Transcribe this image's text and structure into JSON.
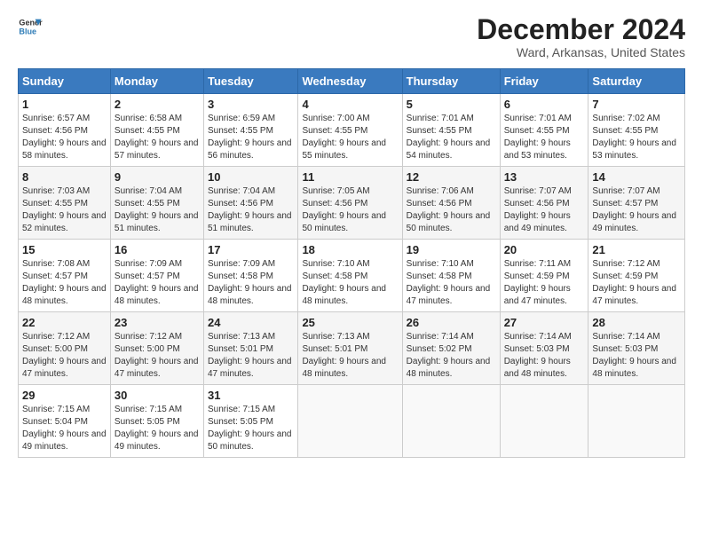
{
  "logo": {
    "general": "General",
    "blue": "Blue"
  },
  "title": "December 2024",
  "subtitle": "Ward, Arkansas, United States",
  "headers": [
    "Sunday",
    "Monday",
    "Tuesday",
    "Wednesday",
    "Thursday",
    "Friday",
    "Saturday"
  ],
  "weeks": [
    [
      {
        "day": "1",
        "sunrise": "Sunrise: 6:57 AM",
        "sunset": "Sunset: 4:56 PM",
        "daylight": "Daylight: 9 hours and 58 minutes."
      },
      {
        "day": "2",
        "sunrise": "Sunrise: 6:58 AM",
        "sunset": "Sunset: 4:55 PM",
        "daylight": "Daylight: 9 hours and 57 minutes."
      },
      {
        "day": "3",
        "sunrise": "Sunrise: 6:59 AM",
        "sunset": "Sunset: 4:55 PM",
        "daylight": "Daylight: 9 hours and 56 minutes."
      },
      {
        "day": "4",
        "sunrise": "Sunrise: 7:00 AM",
        "sunset": "Sunset: 4:55 PM",
        "daylight": "Daylight: 9 hours and 55 minutes."
      },
      {
        "day": "5",
        "sunrise": "Sunrise: 7:01 AM",
        "sunset": "Sunset: 4:55 PM",
        "daylight": "Daylight: 9 hours and 54 minutes."
      },
      {
        "day": "6",
        "sunrise": "Sunrise: 7:01 AM",
        "sunset": "Sunset: 4:55 PM",
        "daylight": "Daylight: 9 hours and 53 minutes."
      },
      {
        "day": "7",
        "sunrise": "Sunrise: 7:02 AM",
        "sunset": "Sunset: 4:55 PM",
        "daylight": "Daylight: 9 hours and 53 minutes."
      }
    ],
    [
      {
        "day": "8",
        "sunrise": "Sunrise: 7:03 AM",
        "sunset": "Sunset: 4:55 PM",
        "daylight": "Daylight: 9 hours and 52 minutes."
      },
      {
        "day": "9",
        "sunrise": "Sunrise: 7:04 AM",
        "sunset": "Sunset: 4:55 PM",
        "daylight": "Daylight: 9 hours and 51 minutes."
      },
      {
        "day": "10",
        "sunrise": "Sunrise: 7:04 AM",
        "sunset": "Sunset: 4:56 PM",
        "daylight": "Daylight: 9 hours and 51 minutes."
      },
      {
        "day": "11",
        "sunrise": "Sunrise: 7:05 AM",
        "sunset": "Sunset: 4:56 PM",
        "daylight": "Daylight: 9 hours and 50 minutes."
      },
      {
        "day": "12",
        "sunrise": "Sunrise: 7:06 AM",
        "sunset": "Sunset: 4:56 PM",
        "daylight": "Daylight: 9 hours and 50 minutes."
      },
      {
        "day": "13",
        "sunrise": "Sunrise: 7:07 AM",
        "sunset": "Sunset: 4:56 PM",
        "daylight": "Daylight: 9 hours and 49 minutes."
      },
      {
        "day": "14",
        "sunrise": "Sunrise: 7:07 AM",
        "sunset": "Sunset: 4:57 PM",
        "daylight": "Daylight: 9 hours and 49 minutes."
      }
    ],
    [
      {
        "day": "15",
        "sunrise": "Sunrise: 7:08 AM",
        "sunset": "Sunset: 4:57 PM",
        "daylight": "Daylight: 9 hours and 48 minutes."
      },
      {
        "day": "16",
        "sunrise": "Sunrise: 7:09 AM",
        "sunset": "Sunset: 4:57 PM",
        "daylight": "Daylight: 9 hours and 48 minutes."
      },
      {
        "day": "17",
        "sunrise": "Sunrise: 7:09 AM",
        "sunset": "Sunset: 4:58 PM",
        "daylight": "Daylight: 9 hours and 48 minutes."
      },
      {
        "day": "18",
        "sunrise": "Sunrise: 7:10 AM",
        "sunset": "Sunset: 4:58 PM",
        "daylight": "Daylight: 9 hours and 48 minutes."
      },
      {
        "day": "19",
        "sunrise": "Sunrise: 7:10 AM",
        "sunset": "Sunset: 4:58 PM",
        "daylight": "Daylight: 9 hours and 47 minutes."
      },
      {
        "day": "20",
        "sunrise": "Sunrise: 7:11 AM",
        "sunset": "Sunset: 4:59 PM",
        "daylight": "Daylight: 9 hours and 47 minutes."
      },
      {
        "day": "21",
        "sunrise": "Sunrise: 7:12 AM",
        "sunset": "Sunset: 4:59 PM",
        "daylight": "Daylight: 9 hours and 47 minutes."
      }
    ],
    [
      {
        "day": "22",
        "sunrise": "Sunrise: 7:12 AM",
        "sunset": "Sunset: 5:00 PM",
        "daylight": "Daylight: 9 hours and 47 minutes."
      },
      {
        "day": "23",
        "sunrise": "Sunrise: 7:12 AM",
        "sunset": "Sunset: 5:00 PM",
        "daylight": "Daylight: 9 hours and 47 minutes."
      },
      {
        "day": "24",
        "sunrise": "Sunrise: 7:13 AM",
        "sunset": "Sunset: 5:01 PM",
        "daylight": "Daylight: 9 hours and 47 minutes."
      },
      {
        "day": "25",
        "sunrise": "Sunrise: 7:13 AM",
        "sunset": "Sunset: 5:01 PM",
        "daylight": "Daylight: 9 hours and 48 minutes."
      },
      {
        "day": "26",
        "sunrise": "Sunrise: 7:14 AM",
        "sunset": "Sunset: 5:02 PM",
        "daylight": "Daylight: 9 hours and 48 minutes."
      },
      {
        "day": "27",
        "sunrise": "Sunrise: 7:14 AM",
        "sunset": "Sunset: 5:03 PM",
        "daylight": "Daylight: 9 hours and 48 minutes."
      },
      {
        "day": "28",
        "sunrise": "Sunrise: 7:14 AM",
        "sunset": "Sunset: 5:03 PM",
        "daylight": "Daylight: 9 hours and 48 minutes."
      }
    ],
    [
      {
        "day": "29",
        "sunrise": "Sunrise: 7:15 AM",
        "sunset": "Sunset: 5:04 PM",
        "daylight": "Daylight: 9 hours and 49 minutes."
      },
      {
        "day": "30",
        "sunrise": "Sunrise: 7:15 AM",
        "sunset": "Sunset: 5:05 PM",
        "daylight": "Daylight: 9 hours and 49 minutes."
      },
      {
        "day": "31",
        "sunrise": "Sunrise: 7:15 AM",
        "sunset": "Sunset: 5:05 PM",
        "daylight": "Daylight: 9 hours and 50 minutes."
      },
      null,
      null,
      null,
      null
    ]
  ]
}
